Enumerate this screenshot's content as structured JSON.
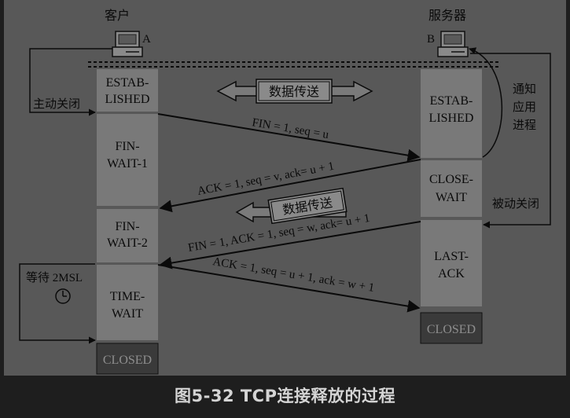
{
  "figure_caption": "图5-32 TCP连接释放的过程",
  "hosts": {
    "client": {
      "label": "客户",
      "letter": "A"
    },
    "server": {
      "label": "服务器",
      "letter": "B"
    }
  },
  "client_states": {
    "established": [
      "ESTAB-",
      "LISHED"
    ],
    "fin_wait_1": [
      "FIN-",
      "WAIT-1"
    ],
    "fin_wait_2": [
      "FIN-",
      "WAIT-2"
    ],
    "time_wait": [
      "TIME-",
      "WAIT"
    ],
    "closed": "CLOSED"
  },
  "server_states": {
    "established": [
      "ESTAB-",
      "LISHED"
    ],
    "close_wait": [
      "CLOSE-",
      "WAIT"
    ],
    "last_ack": [
      "LAST-",
      "ACK"
    ],
    "closed": "CLOSED"
  },
  "annotations": {
    "active_close": "主动关闭",
    "passive_close": "被动关闭",
    "notify_app": [
      "通知",
      "应用",
      "进程"
    ],
    "wait_2msl": "等待 2MSL",
    "data_transfer_1": "数据传送",
    "data_transfer_2": "数据传送"
  },
  "messages": {
    "m1": "FIN = 1, seq = u",
    "m2": "ACK = 1, seq = v, ack= u + 1",
    "m3": "FIN = 1, ACK = 1, seq = w, ack= u + 1",
    "m4": "ACK = 1, seq = u + 1, ack = w + 1"
  },
  "icons": {
    "client_computer": "computer-icon",
    "server_computer": "computer-icon",
    "clock": "clock-icon"
  },
  "colors": {
    "page_bg": "#1e1e1e",
    "diagram_bg": "#585858",
    "state_box": "#797979",
    "closed_box": "#3a3a3a",
    "ink": "#0a0a0a",
    "caption": "#d4d4d4"
  }
}
